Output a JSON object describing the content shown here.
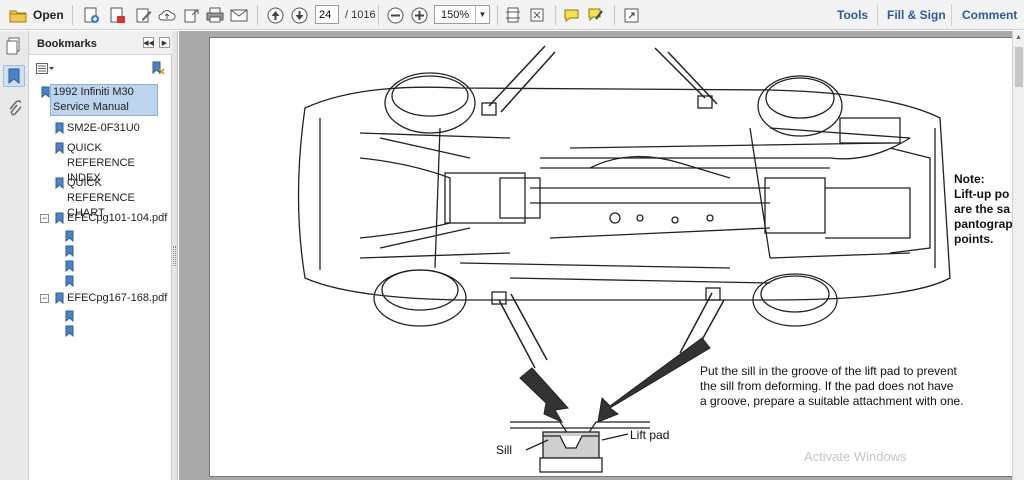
{
  "toolbar": {
    "open_label": "Open",
    "page_current": "24",
    "page_total": "/ 1016",
    "zoom": "150%",
    "tools_label": "Tools",
    "fill_sign_label": "Fill & Sign",
    "comment_label": "Comment"
  },
  "bookmarks": {
    "title": "Bookmarks",
    "items": [
      {
        "label_line1": "1992 Infiniti M30",
        "label_line2": "Service Manual"
      },
      {
        "label_line1": "SM2E-0F31U0",
        "label_line2": ""
      },
      {
        "label_line1": "QUICK REFERENCE",
        "label_line2": "INDEX"
      },
      {
        "label_line1": "QUICK REFERENCE",
        "label_line2": "CHART"
      },
      {
        "label_line1": "EFECpg101-104.pdf",
        "label_line2": ""
      },
      {
        "label_line1": "EFECpg167-168.pdf",
        "label_line2": ""
      }
    ]
  },
  "document": {
    "note_lines": "Note:\nLift-up po\nare the sa\npantograp\npoints.",
    "instruction_line1": "Put the sill in the groove of the lift pad to prevent",
    "instruction_line2": "the sill from deforming. If the pad does not have",
    "instruction_line3": "a groove, prepare a suitable attachment with one.",
    "label_sill": "Sill",
    "label_lift_pad": "Lift pad"
  },
  "watermark": "Activate Windows",
  "colors": {
    "accent": "#2a5d9e",
    "selection": "#bcd4ee"
  }
}
